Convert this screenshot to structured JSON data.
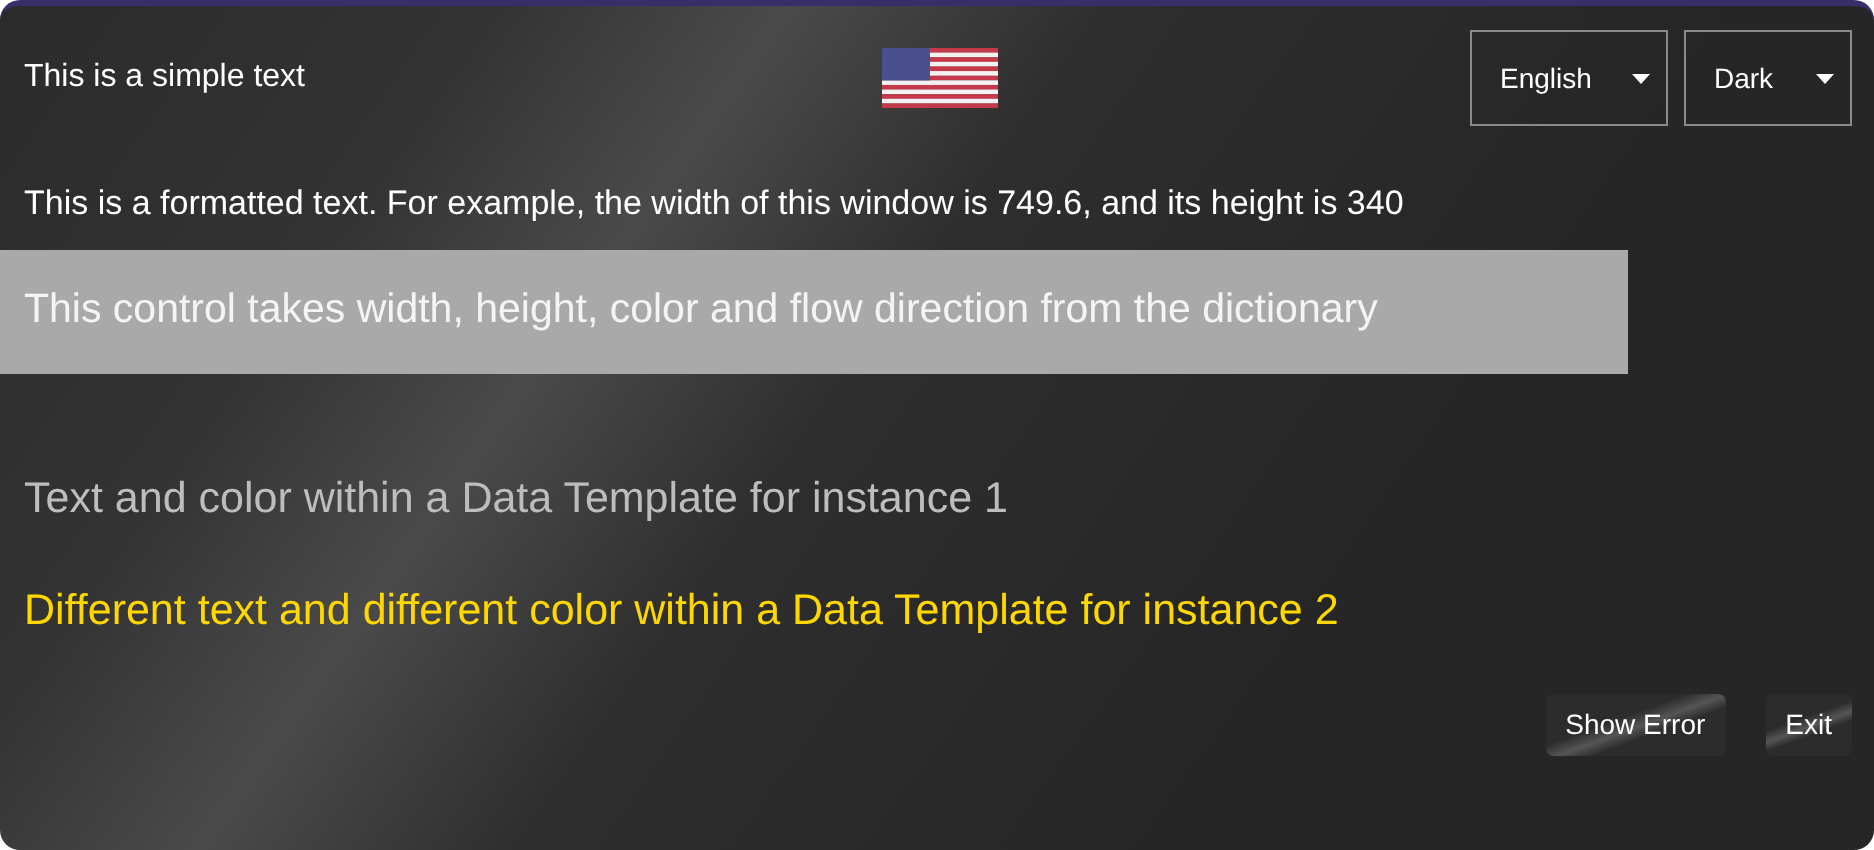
{
  "header": {
    "simple_text": "This is a simple text",
    "dropdowns": [
      {
        "value": "English"
      },
      {
        "value": "Dark"
      }
    ]
  },
  "formatted_text": "This is a formatted text. For example, the width of this window is 749.6, and its height is 340",
  "dictionary_control": {
    "text": "This control takes width, height, color and flow direction from the dictionary",
    "color": "#a9a9a9"
  },
  "template_items": [
    {
      "text": "Text and color within a Data Template for instance 1",
      "color": "#bdbdbd"
    },
    {
      "text": "Different text and different color within a Data Template for instance 2",
      "color": "#ffd700"
    }
  ],
  "buttons": [
    "Show Error",
    "Exit"
  ]
}
